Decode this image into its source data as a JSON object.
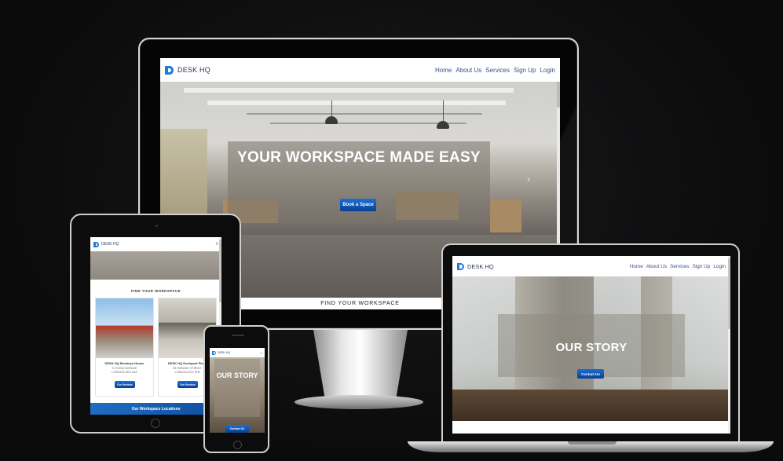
{
  "brand": {
    "name": "DESK HQ"
  },
  "nav": {
    "items": [
      "Home",
      "About Us",
      "Services",
      "Sign Up",
      "Login"
    ]
  },
  "desktop": {
    "hero_title": "YOUR WORKSPACE MADE EASY",
    "cta_label": "Book a Space",
    "next_arrow": "›",
    "section_title": "FIND YOUR WORKSPACE"
  },
  "tablet": {
    "menu_icon": "≡",
    "section_title": "FIND YOUR WORKSPACE",
    "cards": [
      {
        "title": "DESK HQ Brooklyn House",
        "address_line1": "3 STONE AVENUE",
        "address_line2": "LONDON SE5 2AZ",
        "button": "Our Services"
      },
      {
        "title": "DESK HQ Dockyard Place",
        "address_line1": "55 PARADE STREET",
        "address_line2": "LONDON E20 3FB",
        "button": "Our Services"
      }
    ],
    "locations_label": "Our Workspace Locations"
  },
  "phone": {
    "menu_icon": "≡",
    "hero_title": "OUR STORY",
    "cta_label": "Contact Us"
  },
  "laptop": {
    "hero_title": "OUR STORY",
    "cta_label": "Contact Us"
  },
  "colors": {
    "accent": "#1d7bd8",
    "nav_link": "#3d4f90",
    "button_top": "#1a6fd6",
    "button_bottom": "#0a3f92",
    "background": "#0b0b0c"
  }
}
